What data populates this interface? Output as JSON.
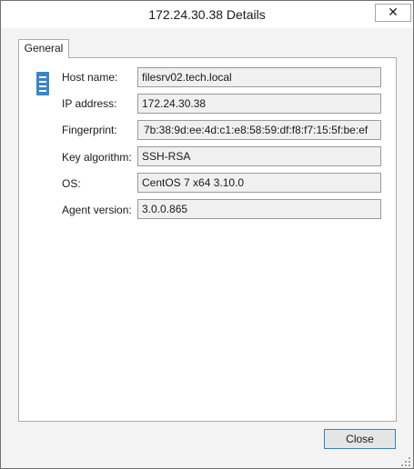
{
  "window": {
    "title": "172.24.30.38 Details",
    "close_glyph": "✕"
  },
  "tabs": [
    {
      "label": "General"
    }
  ],
  "host_icon": "server-icon",
  "fields": [
    {
      "label": "Host name:",
      "value": "filesrv02.tech.local"
    },
    {
      "label": "IP address:",
      "value": "172.24.30.38"
    },
    {
      "label": "Fingerprint:",
      "value": "7b:38:9d:ee:4d:c1:e8:58:59:df:f8:f7:15:5f:be:ef"
    },
    {
      "label": "Key algorithm:",
      "value": "SSH-RSA"
    },
    {
      "label": "OS:",
      "value": "CentOS 7 x64 3.10.0"
    },
    {
      "label": "Agent version:",
      "value": "3.0.0.865"
    }
  ],
  "footer": {
    "close_label": "Close"
  },
  "colors": {
    "icon_blue": "#3a86c8",
    "button_border": "#3c7fb1"
  }
}
